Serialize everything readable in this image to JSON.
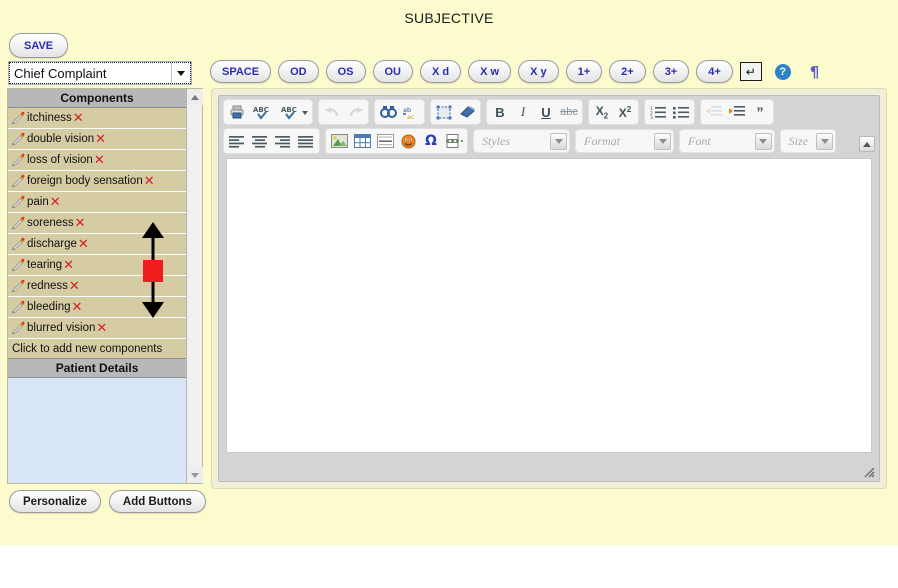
{
  "page": {
    "title": "SUBJECTIVE",
    "background": "#fcfbcd"
  },
  "toolbar_left": {
    "save_label": "SAVE",
    "select": {
      "value": "Chief Complaint",
      "arrow_icon": "chevron-down-icon"
    }
  },
  "components_panel": {
    "header": "Components",
    "items": [
      {
        "label": "itchiness",
        "edit_icon": "pencil-icon",
        "delete_icon": "x-icon"
      },
      {
        "label": "double vision",
        "edit_icon": "pencil-icon",
        "delete_icon": "x-icon"
      },
      {
        "label": "loss of vision",
        "edit_icon": "pencil-icon",
        "delete_icon": "x-icon"
      },
      {
        "label": "foreign body sensation",
        "edit_icon": "pencil-icon",
        "delete_icon": "x-icon"
      },
      {
        "label": "pain",
        "edit_icon": "pencil-icon",
        "delete_icon": "x-icon"
      },
      {
        "label": "soreness",
        "edit_icon": "pencil-icon",
        "delete_icon": "x-icon"
      },
      {
        "label": "discharge",
        "edit_icon": "pencil-icon",
        "delete_icon": "x-icon"
      },
      {
        "label": "tearing",
        "edit_icon": "pencil-icon",
        "delete_icon": "x-icon"
      },
      {
        "label": "redness",
        "edit_icon": "pencil-icon",
        "delete_icon": "x-icon"
      },
      {
        "label": "bleeding",
        "edit_icon": "pencil-icon",
        "delete_icon": "x-icon"
      },
      {
        "label": "blurred vision",
        "edit_icon": "pencil-icon",
        "delete_icon": "x-icon"
      }
    ],
    "add_row": "Click to add new components",
    "patient_details_header": "Patient Details",
    "x_color": "#d61f1f",
    "row_color": "#d5ccA4",
    "header_color": "#b8b8b8",
    "patient_panel_color": "#d8e6f7"
  },
  "annotation": {
    "type": "double-arrow-with-thumb",
    "thumb_color": "#ee1c1c"
  },
  "bottom_buttons": [
    {
      "label": "Personalize"
    },
    {
      "label": "Add Buttons"
    }
  ],
  "quick_buttons": [
    {
      "label": "SPACE"
    },
    {
      "label": "OD"
    },
    {
      "label": "OS"
    },
    {
      "label": "OU"
    },
    {
      "label": "X d"
    },
    {
      "label": "X w"
    },
    {
      "label": "X y"
    },
    {
      "label": "1+"
    },
    {
      "label": "2+"
    },
    {
      "label": "3+"
    },
    {
      "label": "4+"
    }
  ],
  "quick_icons": {
    "enter_key": "↵",
    "enter_name": "enter-key-icon",
    "help": "?",
    "help_name": "help-icon",
    "pilcrow": "¶",
    "pilcrow_name": "pilcrow-icon"
  },
  "editor": {
    "row1": {
      "group1": [
        "print-icon",
        "spellcheck-icon",
        "spellcheck-options-icon"
      ],
      "group2": [
        "undo-icon",
        "redo-icon"
      ],
      "group3": [
        "find-icon",
        "replace-icon"
      ],
      "group4": [
        "select-all-icon",
        "remove-format-icon"
      ],
      "group5": [
        "bold-icon",
        "italic-icon",
        "underline-icon",
        "strikethrough-icon"
      ],
      "group6": [
        "subscript-icon",
        "superscript-icon"
      ],
      "group7": [
        "numbered-list-icon",
        "bulleted-list-icon"
      ],
      "group8": [
        "outdent-icon",
        "indent-icon",
        "blockquote-icon"
      ]
    },
    "row2": {
      "group1": [
        "align-left-icon",
        "align-center-icon",
        "align-right-icon",
        "justify-icon"
      ],
      "group2": [
        "image-icon",
        "table-icon",
        "horizontal-rule-icon",
        "smiley-icon",
        "special-character-icon",
        "page-break-icon"
      ]
    },
    "combos": [
      {
        "label": "Styles",
        "name": "styles-combo"
      },
      {
        "label": "Format",
        "name": "format-combo"
      },
      {
        "label": "Font",
        "name": "font-combo"
      },
      {
        "label": "Size",
        "name": "size-combo"
      }
    ],
    "body_text": "",
    "collapse_icon": "collapse-toolbar-icon",
    "resize_icon": "resize-grip-icon"
  }
}
